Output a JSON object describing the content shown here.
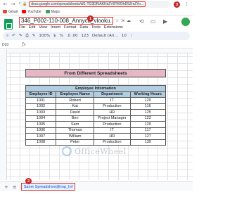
{
  "browser": {
    "url": "docs.google.com/spreadsheets/d/1-TG3DRiAKKbZV9TKfDhD5ZmZYo..."
  },
  "bookmarks": [
    {
      "label": "Gmail",
      "color": "#ea4335"
    },
    {
      "label": "YouTube",
      "color": "#ff0000"
    },
    {
      "label": "Maps",
      "color": "#34a853"
    }
  ],
  "doc": {
    "title": "346_P002-110-008_Annyca_vlooku...",
    "menu": [
      "File",
      "Edit",
      "View",
      "Insert",
      "Format",
      "Data",
      "Tools",
      "Extensions"
    ]
  },
  "toolbar": {
    "zoom": "100%",
    "currency": "$",
    "percent": "%",
    "decimals": ".0  .00",
    "number_format": "123",
    "font": "Default (Ari...",
    "font_size": "10"
  },
  "formula_bar": {
    "cell_ref": "D33"
  },
  "sheet": {
    "banner": "From Different Spreadsheets",
    "table_caption": "Employee Information",
    "headers": [
      "Employee ID",
      "Employee Name",
      "Department",
      "Working Hours"
    ],
    "rows": [
      [
        "1001",
        "Robert",
        "IT",
        "120"
      ],
      [
        "1002",
        "Kat",
        "Production",
        "116"
      ],
      [
        "1003",
        "David",
        "HR",
        "125"
      ],
      [
        "1004",
        "Ben",
        "Project Manager",
        "122"
      ],
      [
        "1005",
        "Sam",
        "Production",
        "120"
      ],
      [
        "1006",
        "Thomas",
        "IT",
        "117"
      ],
      [
        "1007",
        "William",
        "HR",
        "127"
      ],
      [
        "1008",
        "Peter",
        "Production",
        "130"
      ]
    ]
  },
  "watermark": {
    "text": "OfficeWheel"
  },
  "tabs": {
    "active": "Same Spreadsheet(Emp_Inf"
  },
  "callouts": [
    "1",
    "2",
    "3"
  ],
  "colors": {
    "highlight": "#e53935",
    "badge": "#c62828",
    "banner_bg": "#e6b8c6",
    "table_header_bg": "#b3cde0"
  }
}
